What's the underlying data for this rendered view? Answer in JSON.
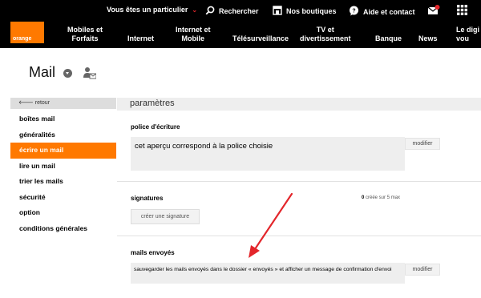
{
  "header": {
    "particulier_label": "Vous êtes un particulier",
    "search_label": "Rechercher",
    "shops_label": "Nos boutiques",
    "help_label": "Aide et contact",
    "mail_badge": "1",
    "logo_text": "orange",
    "nav": [
      {
        "line1": "Mobiles et",
        "line2": "Forfaits"
      },
      {
        "line1": "Internet",
        "line2": ""
      },
      {
        "line1": "Internet et",
        "line2": "Mobile"
      },
      {
        "line1": "Télésurveillance",
        "line2": ""
      },
      {
        "line1": "TV et",
        "line2": "divertissement"
      },
      {
        "line1": "Banque",
        "line2": ""
      },
      {
        "line1": "News",
        "line2": ""
      },
      {
        "line1": "Le digi",
        "line2": "vou"
      }
    ]
  },
  "page": {
    "title": "Mail"
  },
  "sidebar": {
    "back_label": "retour",
    "items": [
      {
        "label": "boîtes mail"
      },
      {
        "label": "généralités"
      },
      {
        "label": "écrire un mail"
      },
      {
        "label": "lire un mail"
      },
      {
        "label": "trier les mails"
      },
      {
        "label": "sécurité"
      },
      {
        "label": "option"
      },
      {
        "label": "conditions générales"
      }
    ],
    "active_index": 2
  },
  "main": {
    "heading": "paramètres",
    "font_section": {
      "title": "police d'écriture",
      "preview": "cet aperçu correspond à la police choisie",
      "modify_label": "modifier"
    },
    "signatures_section": {
      "title": "signatures",
      "count": "0",
      "count_suffix": " créée sur 5 max",
      "create_label": "créer une signature"
    },
    "sent_section": {
      "title": "mails envoyés",
      "description": "sauvegarder les mails envoyés dans le dossier « envoyés » et afficher un message de confirmation d'envoi",
      "modify_label": "modifier"
    }
  },
  "colors": {
    "brand_orange": "#ff7900",
    "annotation_arrow": "#e3262b",
    "header_bg": "#000000"
  }
}
